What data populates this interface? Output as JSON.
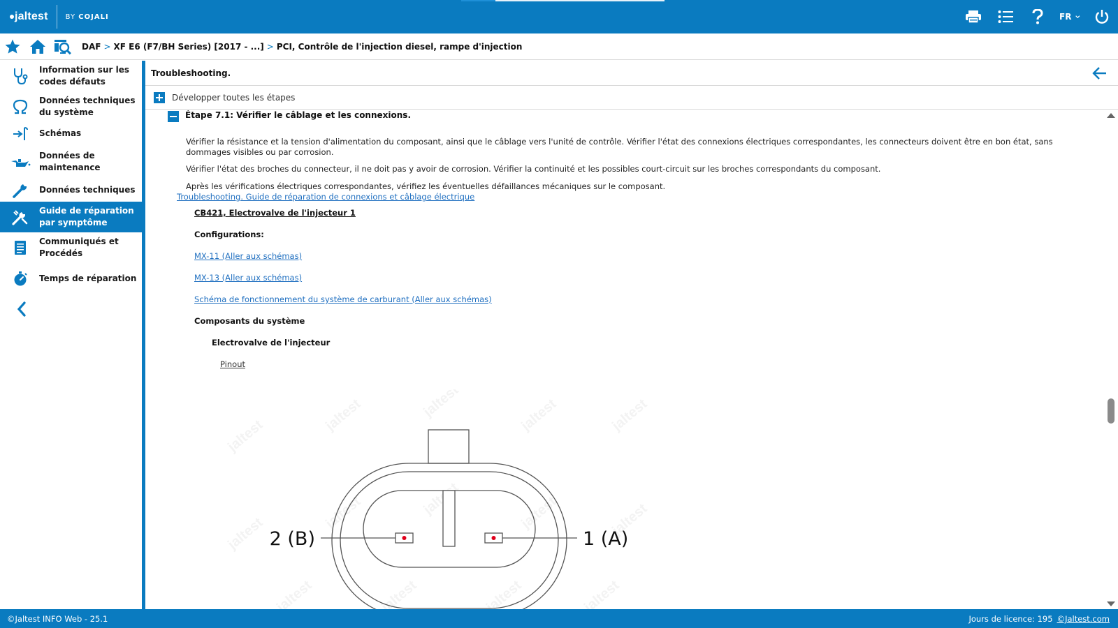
{
  "app": {
    "logo_text": "jaltest",
    "by_label": "BY",
    "by_brand": "COJALI"
  },
  "topbar": {
    "language": "FR"
  },
  "breadcrumb": {
    "items": [
      "DAF",
      "XF E6 (F7/BH Series) [2017 - ...]",
      "PCI, Contrôle de l'injection diesel, rampe d'injection"
    ],
    "separator": ">"
  },
  "sidebar": {
    "items": [
      {
        "label": "Information sur les codes défauts",
        "icon": "stethoscope-icon"
      },
      {
        "label": "Données techniques du système",
        "icon": "omega-icon"
      },
      {
        "label": "Schémas",
        "icon": "connector-icon"
      },
      {
        "label": "Données de maintenance",
        "icon": "oil-can-icon"
      },
      {
        "label": "Données techniques",
        "icon": "wrench-icon"
      },
      {
        "label": "Guide de réparation par symptôme",
        "icon": "repair-tools-icon",
        "active": true
      },
      {
        "label": "Communiqués et Procédés",
        "icon": "document-icon"
      },
      {
        "label": "Temps de réparation",
        "icon": "stopwatch-icon"
      }
    ]
  },
  "content": {
    "title": "Troubleshooting.",
    "expand_all": "Développer toutes les étapes",
    "step_title": "Étape 7.1: Vérifier le câblage et les connexions.",
    "paragraphs": [
      "Vérifier la résistance et la tension d'alimentation du composant, ainsi que le câblage vers l'unité de contrôle. Vérifier l'état des connexions électriques correspondantes, les connecteurs doivent être en bon état, sans dommages visibles ou par corrosion.",
      "Vérifier l'état des broches du connecteur, il ne doit pas y avoir de corrosion. Vérifier la continuité et les possibles court-circuit sur les broches correspondants du composant.",
      "Après les vérifications électriques correspondantes, vérifiez les éventuelles défaillances mécaniques sur le composant."
    ],
    "guide_link": "Troubleshooting. Guide de réparation de connexions et câblage électrique",
    "component_title": "CB421, Electrovalve de l'injecteur 1",
    "configurations_label": "Configurations:",
    "config_links": [
      "MX-11 (Aller aux schémas)",
      "MX-13 (Aller aux schémas)",
      "Schéma de fonctionnement du système de carburant (Aller aux schémas)"
    ],
    "system_components_label": "Composants du système",
    "component_name": "Electrovalve de l'injecteur",
    "pinout_link": "Pinout"
  },
  "diagram": {
    "pin_left": "2 (B)",
    "pin_right": "1 (A)",
    "pin_color": "#e0001b"
  },
  "footer": {
    "version": "©Jaltest INFO Web - 25.1",
    "license": "Jours de licence: 195",
    "site_link": "©Jaltest.com"
  },
  "colors": {
    "brand": "#0a7bc0",
    "link": "#1f6fc0"
  }
}
